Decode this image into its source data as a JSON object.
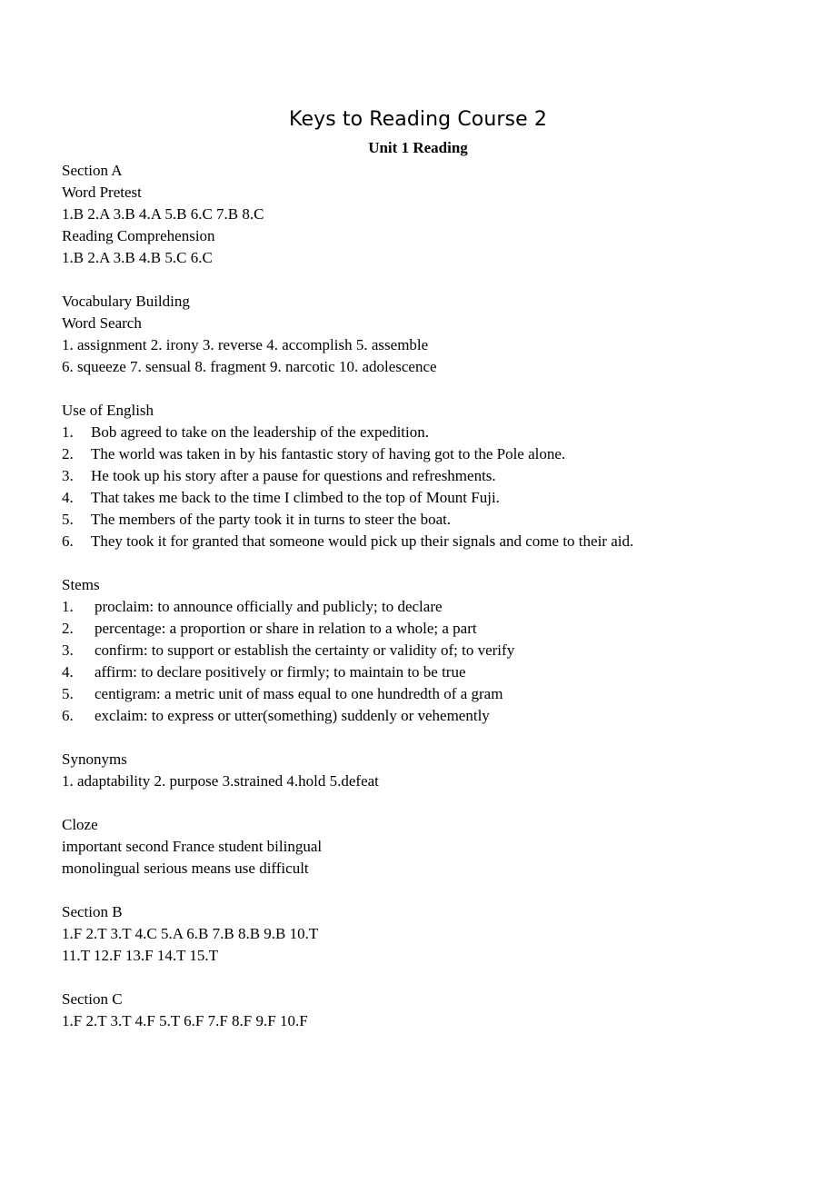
{
  "document": {
    "title": "Keys to Reading Course 2",
    "subtitle": "Unit 1 Reading"
  },
  "sections": {
    "section_a": {
      "heading": "Section A",
      "word_pretest": {
        "heading": "Word Pretest",
        "answers": "1.B 2.A 3.B 4.A 5.B 6.C 7.B 8.C"
      },
      "reading_comprehension": {
        "heading": "Reading Comprehension",
        "answers": "1.B 2.A 3.B 4.B 5.C 6.C"
      },
      "vocabulary_building": {
        "heading": "Vocabulary Building",
        "word_search": {
          "heading": "Word Search",
          "line1": "1. assignment 2. irony 3. reverse 4. accomplish 5. assemble",
          "line2": "6. squeeze 7. sensual 8. fragment 9. narcotic 10. adolescence"
        }
      },
      "use_of_english": {
        "heading": "Use of English",
        "items": [
          {
            "num": "1.",
            "text": "Bob agreed to take on the leadership of the expedition."
          },
          {
            "num": "2.",
            "text": "The world was taken in by his fantastic story of having got to the Pole alone."
          },
          {
            "num": "3.",
            "text": "He took up his story after a pause for questions and refreshments."
          },
          {
            "num": "4.",
            "text": "That takes me back to the time I climbed to the top of Mount Fuji."
          },
          {
            "num": "5.",
            "text": "The members of the party took it in turns to steer the boat."
          },
          {
            "num": "6.",
            "text": "They took it for granted that someone would pick up their signals and come to their aid."
          }
        ]
      },
      "stems": {
        "heading": "Stems",
        "items": [
          {
            "num": "1.",
            "text": "proclaim: to announce officially and publicly; to declare"
          },
          {
            "num": "2.",
            "text": "percentage: a proportion or share in relation to a whole; a part"
          },
          {
            "num": "3.",
            "text": "confirm: to support or establish the certainty or validity of; to verify"
          },
          {
            "num": "4.",
            "text": "affirm: to declare positively or firmly; to maintain to be true"
          },
          {
            "num": "5.",
            "text": "centigram: a metric unit of mass equal to one hundredth of a gram"
          },
          {
            "num": "6.",
            "text": "exclaim: to express or utter(something) suddenly or vehemently"
          }
        ]
      },
      "synonyms": {
        "heading": "Synonyms",
        "answers": "1. adaptability 2. purpose 3.strained 4.hold 5.defeat"
      },
      "cloze": {
        "heading": "Cloze",
        "line1": "important second France student bilingual",
        "line2": "monolingual serious means use difficult"
      }
    },
    "section_b": {
      "heading": "Section B",
      "answers_line1": "1.F 2.T 3.T 4.C 5.A 6.B 7.B 8.B 9.B 10.T",
      "answers_line2": "11.T 12.F 13.F 14.T 15.T"
    },
    "section_c": {
      "heading": "Section C",
      "answers": "1.F 2.T 3.T 4.F 5.T 6.F 7.F 8.F 9.F 10.F"
    }
  }
}
